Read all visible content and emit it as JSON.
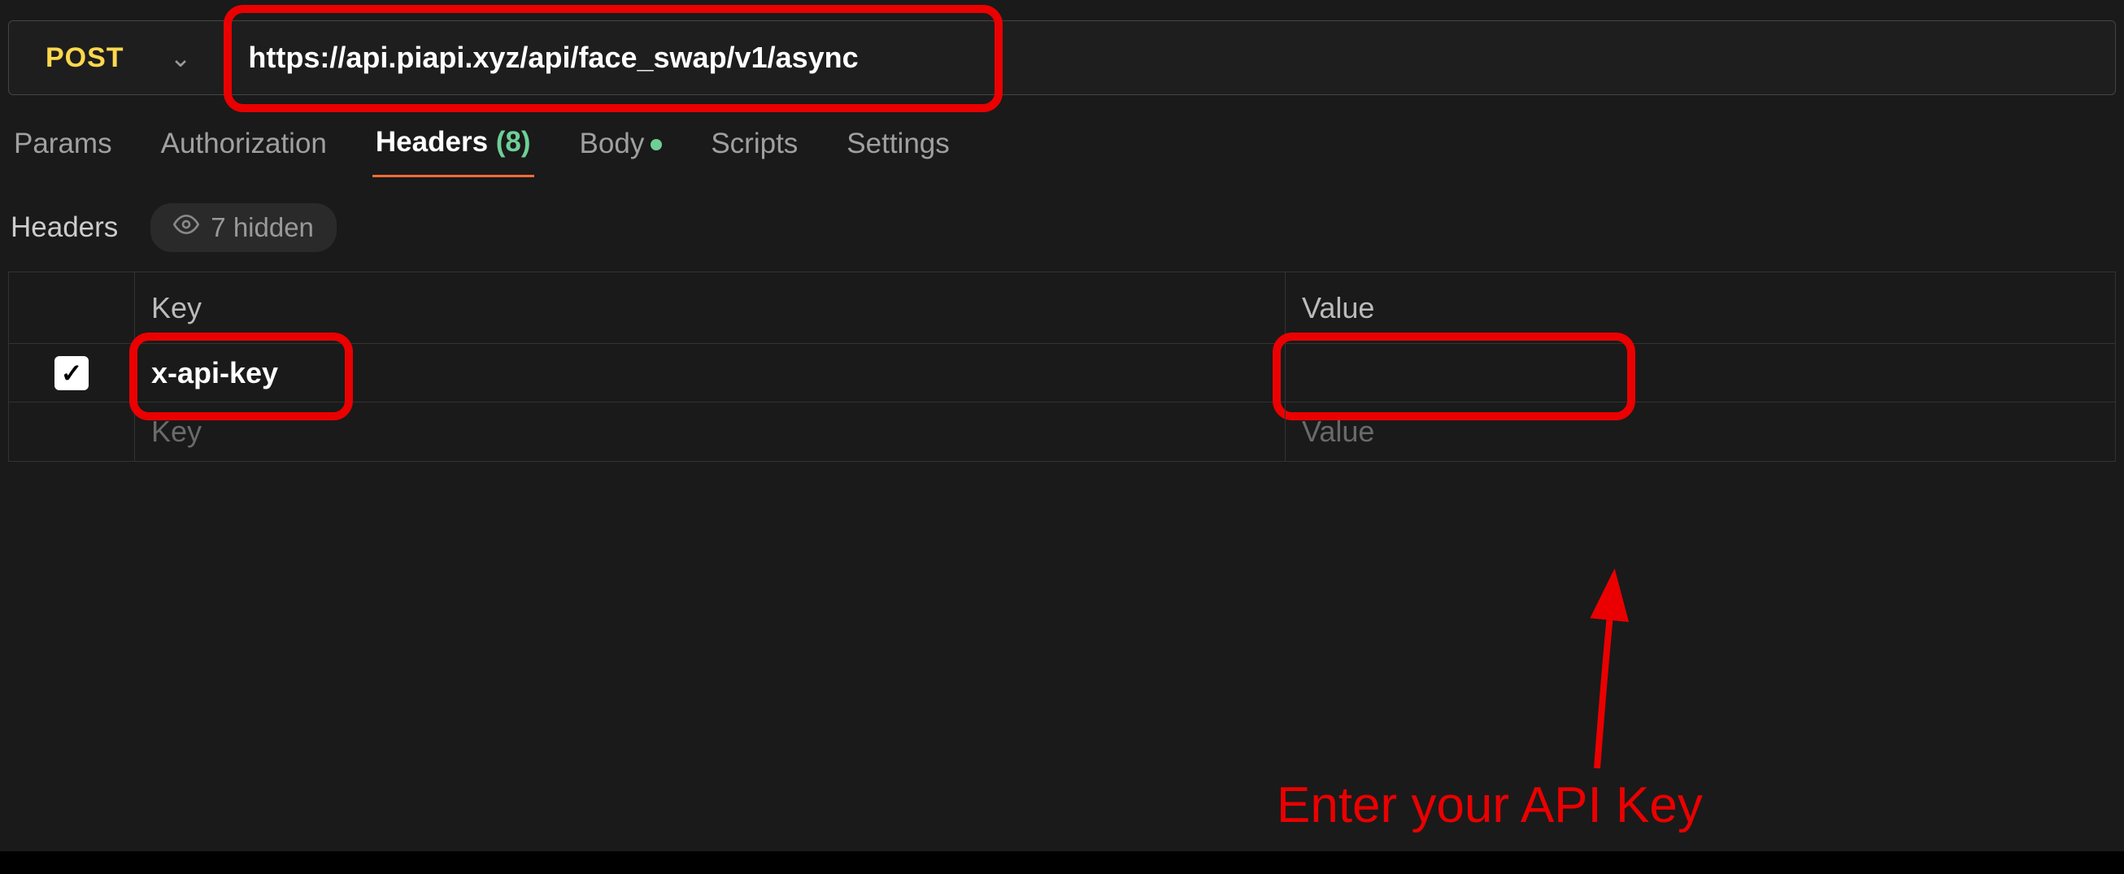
{
  "request": {
    "method": "POST",
    "url": "https://api.piapi.xyz/api/face_swap/v1/async"
  },
  "tabs": {
    "params": "Params",
    "authorization": "Authorization",
    "headers_label": "Headers",
    "headers_count": "(8)",
    "body": "Body",
    "scripts": "Scripts",
    "settings": "Settings"
  },
  "headers_section": {
    "title": "Headers",
    "hidden_count": "7 hidden",
    "columns": {
      "key": "Key",
      "value": "Value"
    },
    "rows": [
      {
        "checked": true,
        "key": "x-api-key",
        "value": ""
      }
    ],
    "placeholder_row": {
      "key_placeholder": "Key",
      "value_placeholder": "Value"
    }
  },
  "annotation": {
    "text": "Enter your API Key"
  }
}
